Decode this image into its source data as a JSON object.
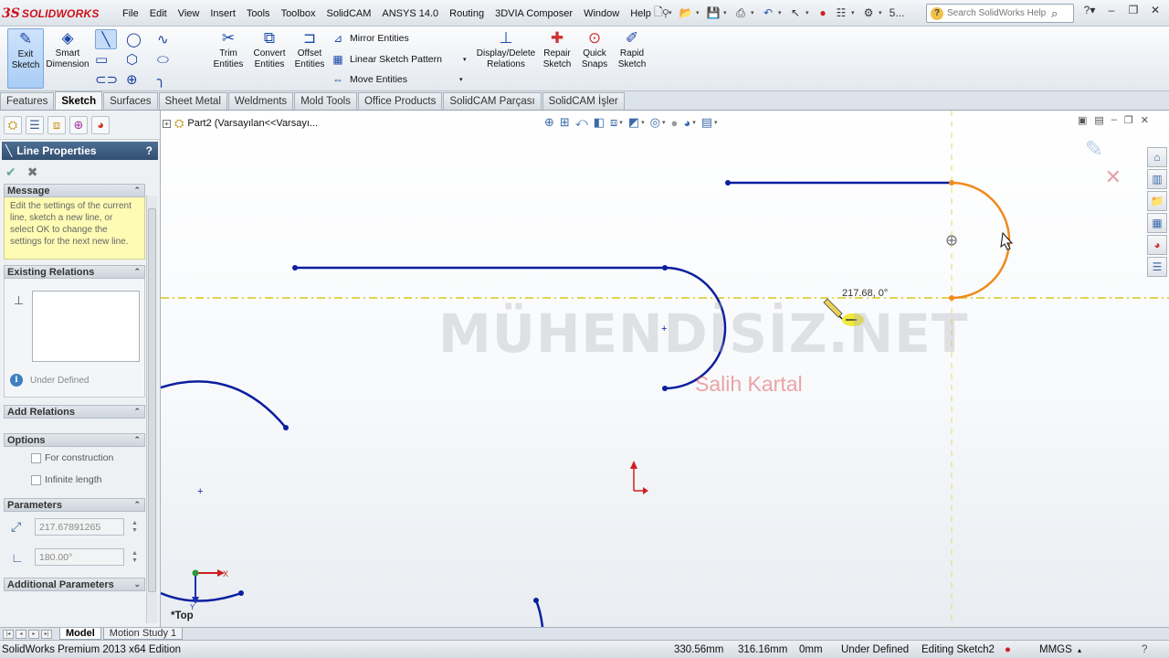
{
  "app": {
    "logo_mark": "3S",
    "logo_name": "SOLIDWORKS",
    "menus": [
      "File",
      "Edit",
      "View",
      "Insert",
      "Tools",
      "Toolbox",
      "SolidCAM",
      "ANSYS 14.0",
      "Routing",
      "3DVIA Composer",
      "Window",
      "Help"
    ],
    "search_placeholder": "Search SolidWorks Help",
    "quick_more": "5..."
  },
  "command_manager": {
    "exit_sketch": "Exit Sketch",
    "smart_dimension": "Smart Dimension",
    "trim_entities": "Trim Entities",
    "convert_entities": "Convert Entities",
    "offset_entities": "Offset Entities",
    "mirror_entities": "Mirror Entities",
    "linear_sketch_pattern": "Linear Sketch Pattern",
    "move_entities": "Move Entities",
    "display_delete_relations": "Display/Delete Relations",
    "repair_sketch": "Repair Sketch",
    "quick_snaps": "Quick Snaps",
    "rapid_sketch": "Rapid Sketch"
  },
  "tabs": [
    "Features",
    "Sketch",
    "Surfaces",
    "Sheet Metal",
    "Weldments",
    "Mold Tools",
    "Office Products",
    "SolidCAM Parçası",
    "SolidCAM İşler"
  ],
  "active_tab": "Sketch",
  "property_manager": {
    "title": "Line Properties",
    "help": "?",
    "message_header": "Message",
    "message_text": "Edit the settings of the current line, sketch a new line, or select OK to change the settings for the next new line.",
    "existing_relations_header": "Existing Relations",
    "status": "Under Defined",
    "add_relations_header": "Add Relations",
    "options_header": "Options",
    "option_construction": "For construction",
    "option_infinite": "Infinite length",
    "parameters_header": "Parameters",
    "length_value": "217.67891265",
    "angle_value": "180.00°",
    "additional_parameters_header": "Additional Parameters"
  },
  "graphics": {
    "part_label": "Part2  (Varsayılan<<Varsayı...",
    "dimension_readout": "217.68, 0°",
    "watermark": "MÜHENDİSİZ.NET",
    "author": "Salih Kartal",
    "view_name": "*Top",
    "triad_x": "X",
    "triad_y": "Y"
  },
  "bottom_tabs": [
    "Model",
    "Motion Study 1"
  ],
  "status_bar": {
    "edition": "SolidWorks Premium 2013 x64 Edition",
    "x": "330.56mm",
    "y": "316.16mm",
    "z": "0mm",
    "definition": "Under Defined",
    "editing": "Editing Sketch2",
    "units": "MMGS"
  },
  "colors": {
    "sketch_blue": "#0b1f9e",
    "arc_orange": "#f08a1c",
    "centerline_yellow": "#d9c71c",
    "accent": "#4d6f94"
  }
}
